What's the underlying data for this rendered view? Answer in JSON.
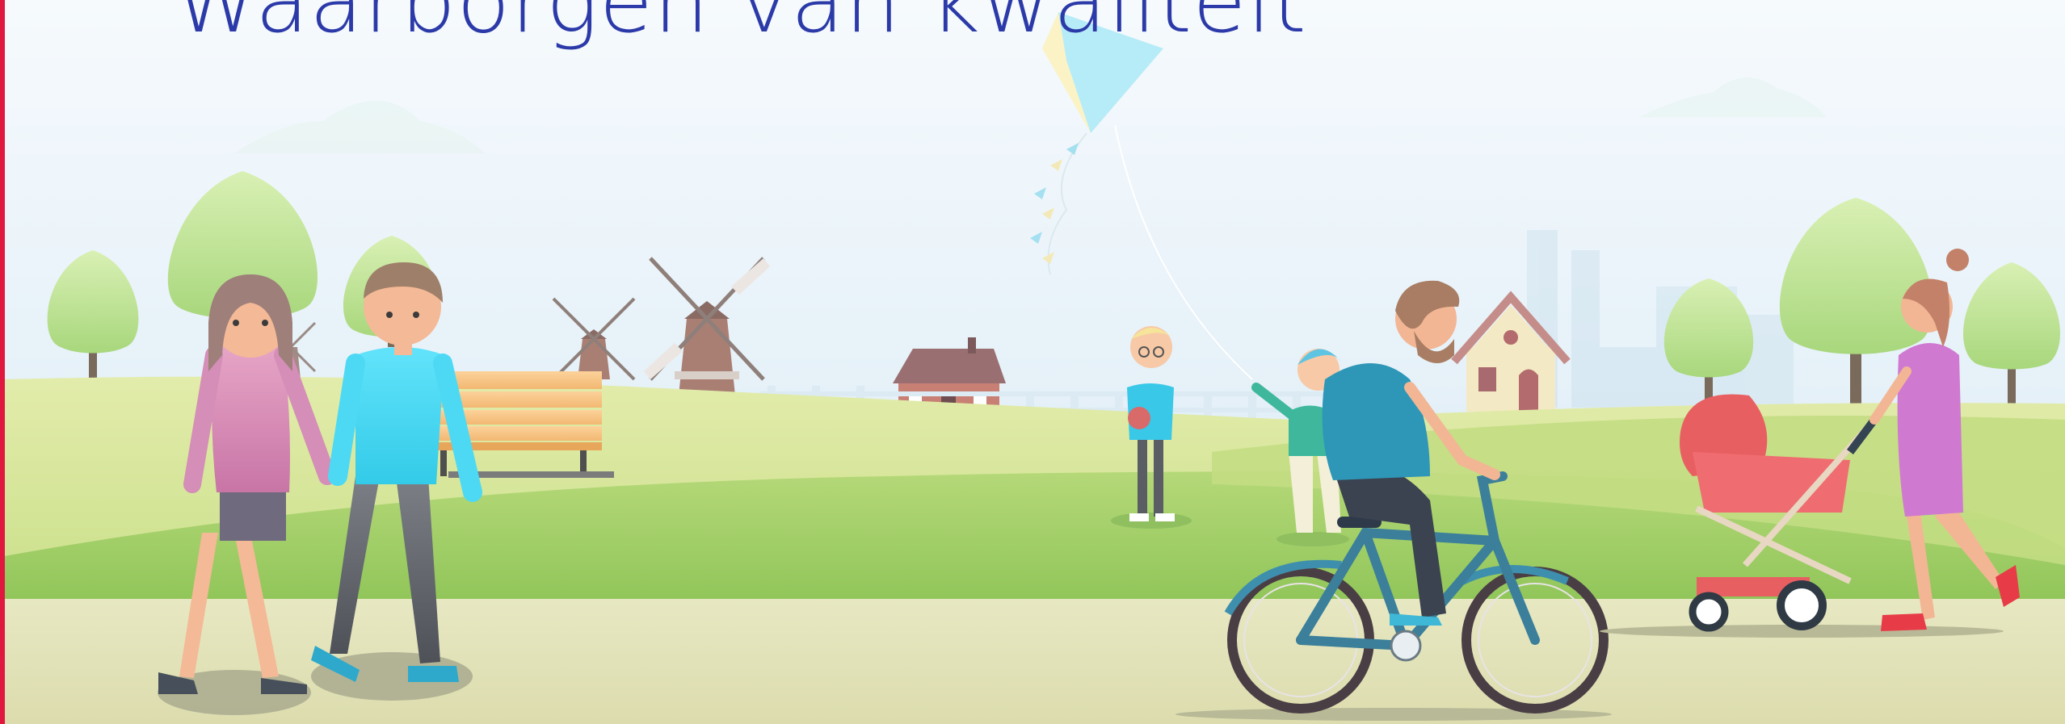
{
  "page": {
    "title": "Waarborgen van kwaliteit"
  },
  "illustration": {
    "subject": "park-scene",
    "colors": {
      "accent_edge": "#e0183f",
      "title": "#2b3aa8",
      "sky_top": "#f6fafd",
      "sky_bottom": "#e7f2f9",
      "grass_light": "#d9e89a",
      "grass_dark": "#a6d16a",
      "path": "#e3e3b8"
    }
  }
}
